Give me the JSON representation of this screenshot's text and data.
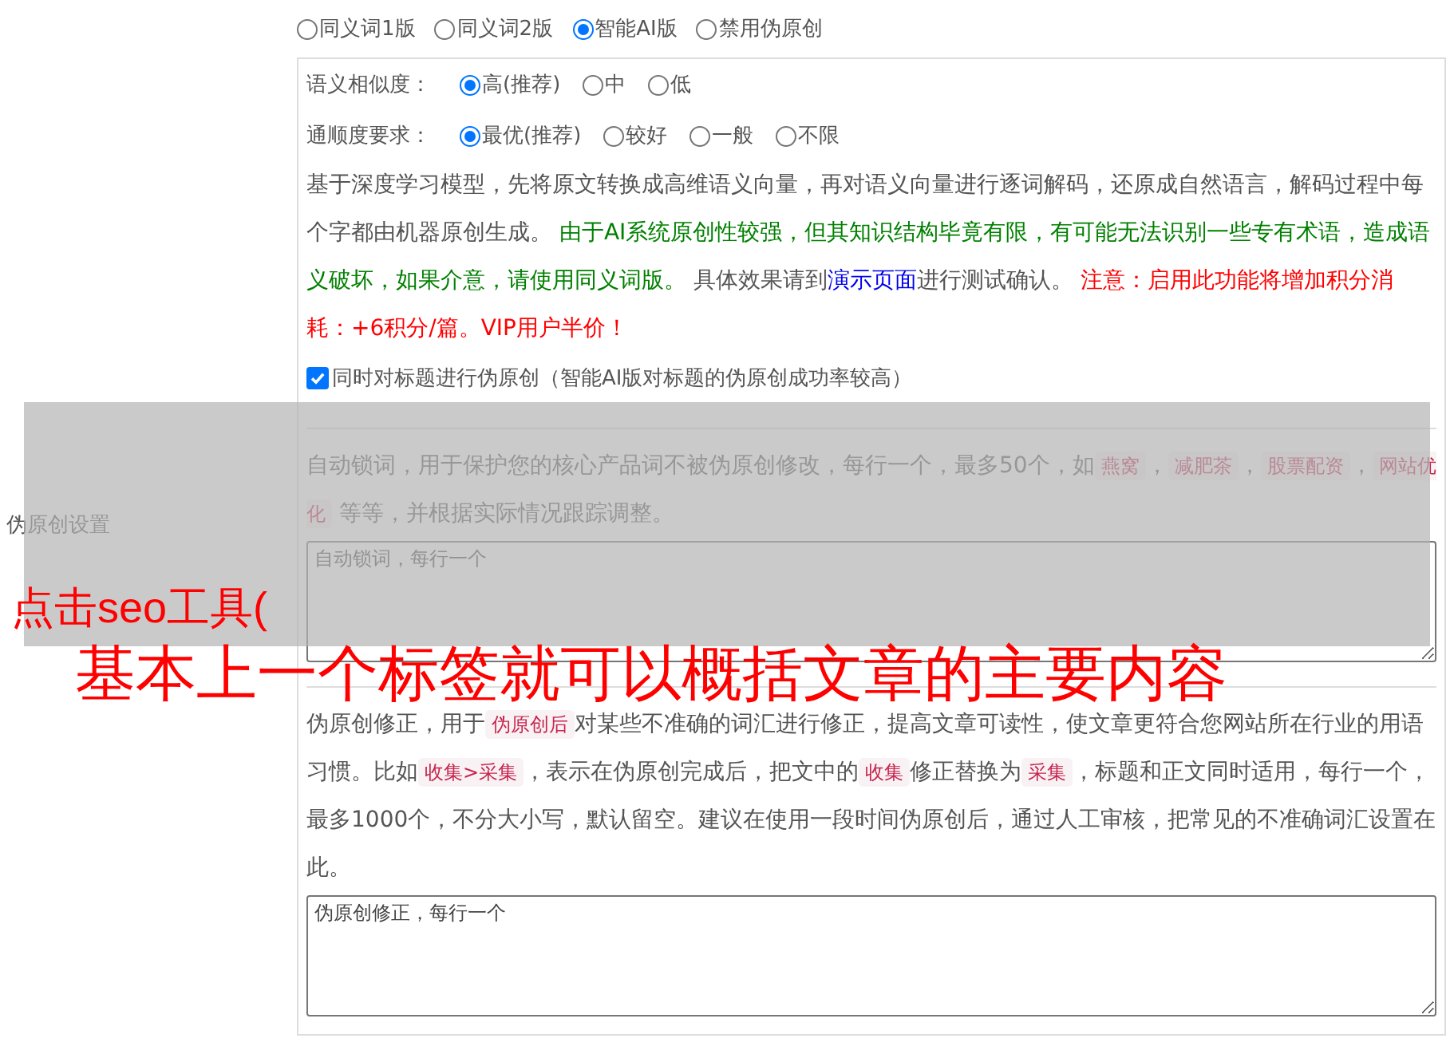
{
  "mode_options": [
    {
      "label": "同义词1版",
      "selected": false
    },
    {
      "label": "同义词2版",
      "selected": false
    },
    {
      "label": "智能AI版",
      "selected": true
    },
    {
      "label": "禁用伪原创",
      "selected": false
    }
  ],
  "settings_label": "伪原创设置",
  "ai_panel": {
    "groups": [
      {
        "label": "语义相似度：",
        "options": [
          {
            "label": "高(推荐)",
            "selected": true
          },
          {
            "label": "中",
            "selected": false
          },
          {
            "label": "低",
            "selected": false
          }
        ]
      },
      {
        "label": "通顺度要求：",
        "options": [
          {
            "label": "最优(推荐)",
            "selected": true
          },
          {
            "label": "较好",
            "selected": false
          },
          {
            "label": "一般",
            "selected": false
          },
          {
            "label": "不限",
            "selected": false
          }
        ]
      }
    ],
    "description": [
      {
        "kind": "text",
        "text": "基于深度学习模型，先将原文转换成高维语义向量，再对语义向量进行逐词解码，还原成自然语言，解码过程中每个字都由机器原创生成。 "
      },
      {
        "kind": "notice",
        "text": "由于AI系统原创性较强，但其知识结构毕竟有限，有可能无法识别一些专有术语，造成语义破坏，如果介意，请使用同义词版。"
      },
      {
        "kind": "text",
        "text": " 具体效果请到"
      },
      {
        "kind": "link",
        "text": "演示页面"
      },
      {
        "kind": "text",
        "text": "进行测试确认。 "
      },
      {
        "kind": "warning",
        "text": "注意：启用此功能将增加积分消耗：+6积分/篇。VIP用户半价！"
      }
    ],
    "title_checkbox": {
      "label": "同时对标题进行伪原创（智能AI版对标题的伪原创成功率较高）",
      "checked": true
    }
  },
  "lock_words": {
    "description": [
      {
        "kind": "text",
        "text": "自动锁词，用于保护您的核心产品词不被伪原创修改，每行一个，最多50个，如"
      },
      {
        "kind": "tag",
        "text": "燕窝"
      },
      {
        "kind": "text",
        "text": "，"
      },
      {
        "kind": "tag",
        "text": "减肥茶"
      },
      {
        "kind": "text",
        "text": "，"
      },
      {
        "kind": "tag",
        "text": "股票配资"
      },
      {
        "kind": "text",
        "text": "，"
      },
      {
        "kind": "tag",
        "text": "网站优化"
      },
      {
        "kind": "text",
        "text": " 等等，并根据实际情况跟踪调整。"
      }
    ],
    "placeholder": "自动锁词，每行一个"
  },
  "correction": {
    "description": [
      {
        "kind": "text",
        "text": "伪原创修正，用于"
      },
      {
        "kind": "tag",
        "text": "伪原创后"
      },
      {
        "kind": "text",
        "text": "对某些不准确的词汇进行修正，提高文章可读性，使文章更符合您网站所在行业的用语习惯。比如"
      },
      {
        "kind": "tag",
        "text": "收集>采集"
      },
      {
        "kind": "text",
        "text": "，表示在伪原创完成后，把文中的"
      },
      {
        "kind": "tag",
        "text": "收集"
      },
      {
        "kind": "text",
        "text": "修正替换为"
      },
      {
        "kind": "tag",
        "text": "采集"
      },
      {
        "kind": "text",
        "text": "，标题和正文同时适用，每行一个，最多1000个，不分大小写，默认留空。建议在使用一段时间伪原创后，通过人工审核，把常见的不准确词汇设置在此。"
      }
    ],
    "placeholder": "伪原创修正，每行一个"
  },
  "overlay": {
    "lines": [
      "点击seo工具(",
      "基本上一个标签就可以概括文章的主要内容"
    ]
  }
}
